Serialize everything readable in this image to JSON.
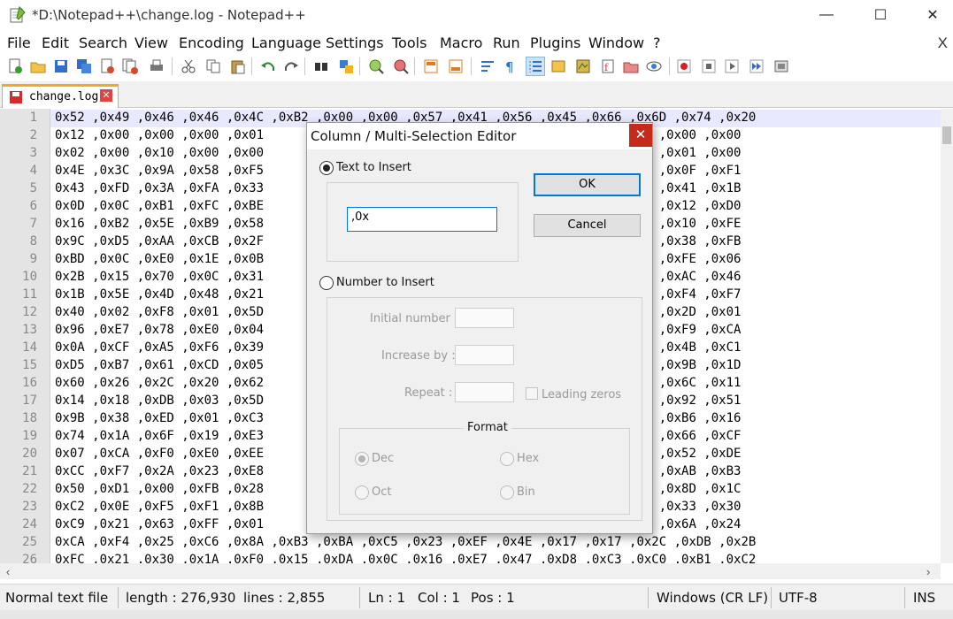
{
  "window": {
    "title": "*D:\\Notepad++\\change.log - Notepad++",
    "minimize": "—",
    "maximize": "☐",
    "close": "✕"
  },
  "menu": {
    "items": [
      "File",
      "Edit",
      "Search",
      "View",
      "Encoding",
      "Language",
      "Settings",
      "Tools",
      "Macro",
      "Run",
      "Plugins",
      "Window",
      "?"
    ],
    "close_doc": "X"
  },
  "tab": {
    "label": "change.log",
    "close": "✕"
  },
  "editor": {
    "line_numbers": [
      "1",
      "2",
      "3",
      "4",
      "5",
      "6",
      "7",
      "8",
      "9",
      "10",
      "11",
      "12",
      "13",
      "14",
      "15",
      "16",
      "17",
      "18",
      "19",
      "20",
      "21",
      "22",
      "23",
      "24",
      "25",
      "26"
    ],
    "lines": [
      "0x52 ,0x49 ,0x46 ,0x46 ,0x4C ,0xB2 ,0x00 ,0x00 ,0x57 ,0x41 ,0x56 ,0x45 ,0x66 ,0x6D ,0x74 ,0x20",
      "0x12 ,0x00 ,0x00 ,0x00 ,0x01                                   ,0x00 ,0xA0 ,0x0F ,0x00 ,0x00",
      "0x02 ,0x00 ,0x10 ,0x00 ,0x00                                   ,0x9C ,0x00 ,0x00 ,0x01 ,0x00",
      "0x4E ,0x3C ,0x9A ,0x58 ,0xF5                                   ,0xD8 ,0x4A ,0xDE ,0x0F ,0xF1",
      "0x43 ,0xFD ,0x3A ,0xFA ,0x33                                   ,0x0B ,0xD8 ,0x1B ,0x41 ,0x1B",
      "0x0D ,0x0C ,0xB1 ,0xFC ,0xBE                                   ,0x18 ,0x68 ,0xFB ,0x12 ,0xD0",
      "0x16 ,0xB2 ,0x5E ,0xB9 ,0x58                                   ,0x59 ,0x31 ,0x34 ,0x10 ,0xFE",
      "0x9C ,0xD5 ,0xAA ,0xCB ,0x2F                                   ,0xF9 ,0x89 ,0xF5 ,0x38 ,0xFB",
      "0xBD ,0x0C ,0xE0 ,0x1E ,0x0B                                   ,0xEE ,0x91 ,0xF3 ,0xFE ,0x06",
      "0x2B ,0x15 ,0x70 ,0x0C ,0x31                                   ,0xD6 ,0xDD ,0x0E ,0xAC ,0x46",
      "0x1B ,0x5E ,0x4D ,0x48 ,0x21                                   ,0xC6 ,0xF2 ,0xDF ,0xF4 ,0xF7",
      "0x40 ,0x02 ,0xF8 ,0x01 ,0x5D                                   ,0x26 ,0xC0 ,0x1B ,0x2D ,0x01",
      "0x96 ,0xE7 ,0x78 ,0xE0 ,0x04                                   ,0x05 ,0x3E ,0xE5 ,0xF9 ,0xCA",
      "0x0A ,0xCF ,0xA5 ,0xF6 ,0x39                                   ,0x28 ,0x3A ,0xED ,0x4B ,0xC1",
      "0xD5 ,0xB7 ,0x61 ,0xCD ,0x05                                   ,0x0E ,0x95 ,0x12 ,0x9B ,0x1D",
      "0x60 ,0x26 ,0x2C ,0x20 ,0x62                                   ,0xDA ,0xB0 ,0xF5 ,0x6C ,0x11",
      "0x14 ,0x18 ,0xDB ,0x03 ,0x5D                                   ,0x11 ,0x2C ,0x40 ,0x92 ,0x51",
      "0x9B ,0x38 ,0xED ,0x01 ,0xC3                                   ,0xE0 ,0x36 ,0x03 ,0xB6 ,0x16",
      "0x74 ,0x1A ,0x6F ,0x19 ,0xE3                                   ,0x0C ,0xD4 ,0xEB ,0x66 ,0xCF",
      "0x07 ,0xCA ,0xF0 ,0xE0 ,0xEE                                   ,0x03 ,0x56 ,0xE5 ,0x52 ,0xDE",
      "0xCC ,0xF7 ,0x2A ,0x23 ,0xE8                                   ,0xDE ,0xFD ,0xB6 ,0xAB ,0xB3",
      "0x50 ,0xD1 ,0x00 ,0xFB ,0x28                                   ,0x1E ,0x2F ,0x1E ,0x8D ,0x1C",
      "0xC2 ,0x0E ,0xF5 ,0xF1 ,0x8B                                   ,0xF5 ,0xE4 ,0x1D ,0x33 ,0x30",
      "0xC9 ,0x21 ,0x63 ,0xFF ,0x01                                   ,0x29 ,0x26 ,0x39 ,0x6A ,0x24",
      "0xCA ,0xF4 ,0x25 ,0xC6 ,0x8A ,0xB3 ,0xBA ,0xC5 ,0x23 ,0xEF ,0x4E ,0x17 ,0x17 ,0x2C ,0xDB ,0x2B",
      "0xFC ,0x21 ,0x30 ,0x1A ,0xF0 ,0x15 ,0xDA ,0x0C ,0x16 ,0xE7 ,0x47 ,0xD8 ,0xC3 ,0xC0 ,0xB1 ,0xC2"
    ]
  },
  "dialog": {
    "title": "Column / Multi-Selection Editor",
    "close": "✕",
    "text_to_insert": {
      "label": "Text to Insert",
      "value": ",0x",
      "checked": true
    },
    "number_to_insert": {
      "label": "Number to Insert",
      "checked": false
    },
    "initial_number_label": "Initial number :",
    "increase_by_label": "Increase by :",
    "repeat_label": "Repeat :",
    "leading_zeros_label": "Leading zeros",
    "format_label": "Format",
    "format_options": [
      "Dec",
      "Hex",
      "Oct",
      "Bin"
    ],
    "format_selected": "Dec",
    "ok_label": "OK",
    "cancel_label": "Cancel"
  },
  "statusbar": {
    "doc_type": "Normal text file",
    "length": "length : 276,930",
    "lines": "lines : 2,855",
    "ln": "Ln : 1",
    "col": "Col : 1",
    "pos": "Pos : 1",
    "eol": "Windows (CR LF)",
    "encoding": "UTF-8",
    "mode": "INS"
  },
  "colors": {
    "current_line": "#e8e8ff",
    "gutter": "#e4e4e4",
    "tab_accent": "#f5a623",
    "dialog_close": "#c42b1c",
    "focus_border": "#0078d7"
  }
}
